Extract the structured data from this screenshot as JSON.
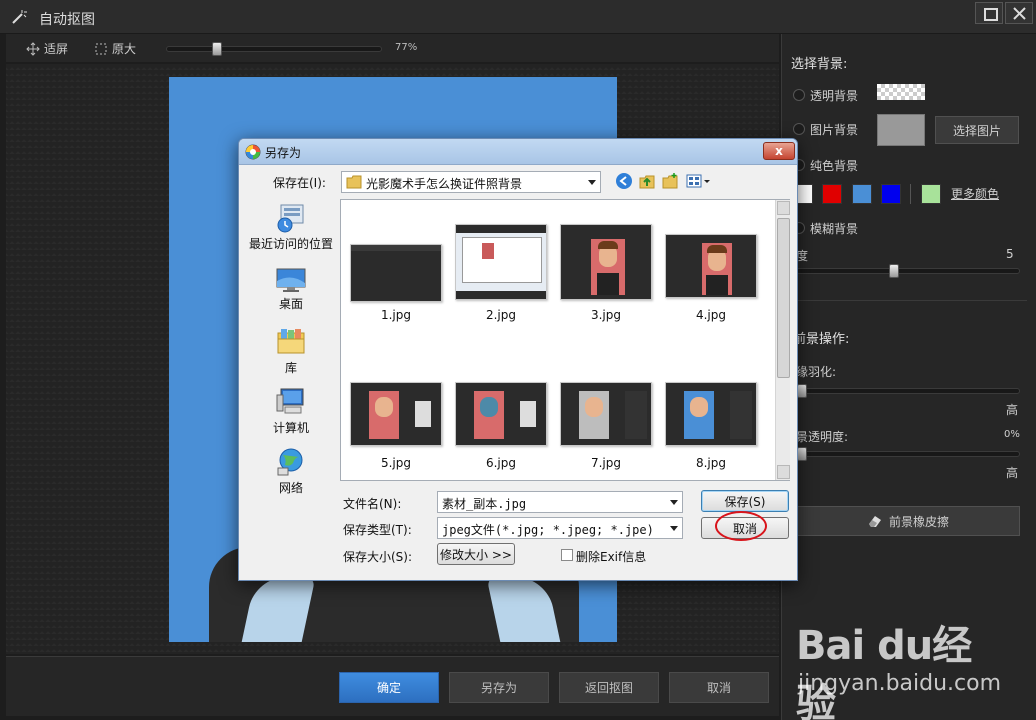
{
  "window": {
    "title": "自动抠图"
  },
  "toolbar": {
    "fit_label": "适屏",
    "original_label": "原大",
    "zoom_percent": "77%",
    "zoom_fraction": 0.22
  },
  "bottom_bar": {
    "confirm_label": "确定",
    "save_as_label": "另存为",
    "back_label": "返回抠图",
    "cancel_label": "取消"
  },
  "right_panel": {
    "select_bg_heading": "选择背景:",
    "transparent_bg_label": "透明背景",
    "image_bg_label": "图片背景",
    "select_image_button": "选择图片",
    "solid_bg_label": "纯色背景",
    "color_swatches": [
      "#ffffff",
      "#e00000",
      "#4a8fd6",
      "#0000ee",
      "#a8e29a"
    ],
    "more_colors_label": "更多颜色",
    "blur_bg_label": "模糊背景",
    "blur_degree_label": "度",
    "blur_degree_value": "5",
    "blur_fraction": 0.43,
    "foreground_heading": "前景操作:",
    "edge_feather_label": "缘羽化:",
    "feather_low": "",
    "feather_high": "高",
    "feather_fraction": 0.0,
    "fg_opacity_label": "景透明度:",
    "fg_opacity_value": "0%",
    "opacity_low": "",
    "opacity_high": "高",
    "opacity_fraction": 0.0,
    "eraser_button": "前景橡皮擦"
  },
  "dialog": {
    "title": "另存为",
    "close_label": "x",
    "save_in_label": "保存在(I):",
    "save_in_value": "光影魔术手怎么换证件照背景",
    "places": [
      {
        "label": "最近访问的位置",
        "icon": "recent-places-icon"
      },
      {
        "label": "桌面",
        "icon": "desktop-icon"
      },
      {
        "label": "库",
        "icon": "library-icon"
      },
      {
        "label": "计算机",
        "icon": "computer-icon"
      },
      {
        "label": "网络",
        "icon": "network-icon"
      }
    ],
    "files": [
      {
        "name": "1.jpg"
      },
      {
        "name": "2.jpg"
      },
      {
        "name": "3.jpg"
      },
      {
        "name": "4.jpg"
      },
      {
        "name": "5.jpg"
      },
      {
        "name": "6.jpg"
      },
      {
        "name": "7.jpg"
      },
      {
        "name": "8.jpg"
      }
    ],
    "filename_label": "文件名(N):",
    "filename_value": "素材_副本.jpg",
    "filetype_label": "保存类型(T):",
    "filetype_value": "jpeg文件(*.jpg; *.jpeg; *.jpe)",
    "filesize_label": "保存大小(S):",
    "resize_button": "修改大小 >>",
    "remove_exif_label": "删除Exif信息",
    "save_button": "保存(S)",
    "cancel_button": "取消"
  },
  "watermark": {
    "logo": "Bai du经验",
    "url": "jingyan.baidu.com"
  }
}
